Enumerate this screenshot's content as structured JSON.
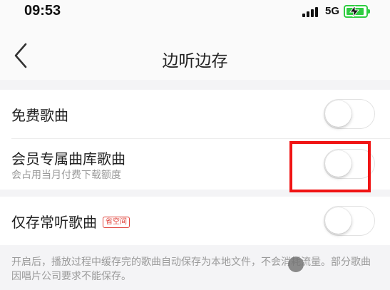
{
  "status_bar": {
    "time": "09:53",
    "network": "5G",
    "battery_charging": true,
    "battery_level_percent": 80,
    "signal_bars": 4
  },
  "nav": {
    "back_icon": "chevron-left-icon",
    "title": "边听边存"
  },
  "settings": {
    "free_songs": {
      "label": "免费歌曲",
      "enabled": false
    },
    "vip_songs": {
      "label": "会员专属曲库歌曲",
      "subtitle": "会占用当月付费下载额度",
      "enabled": false
    },
    "frequent_songs": {
      "label": "仅存常听歌曲",
      "badge": "省空间",
      "enabled": false
    }
  },
  "footer": {
    "note": "开启后，播放过程中缓存完的歌曲自动保存为本地文件，不会消耗流量。部分歌曲因唱片公司要求不能保存。"
  },
  "colors": {
    "accent_red": "#e0433b",
    "highlight_red": "#f01414",
    "battery_green": "#2ecc40",
    "background": "#f4f4f6"
  }
}
